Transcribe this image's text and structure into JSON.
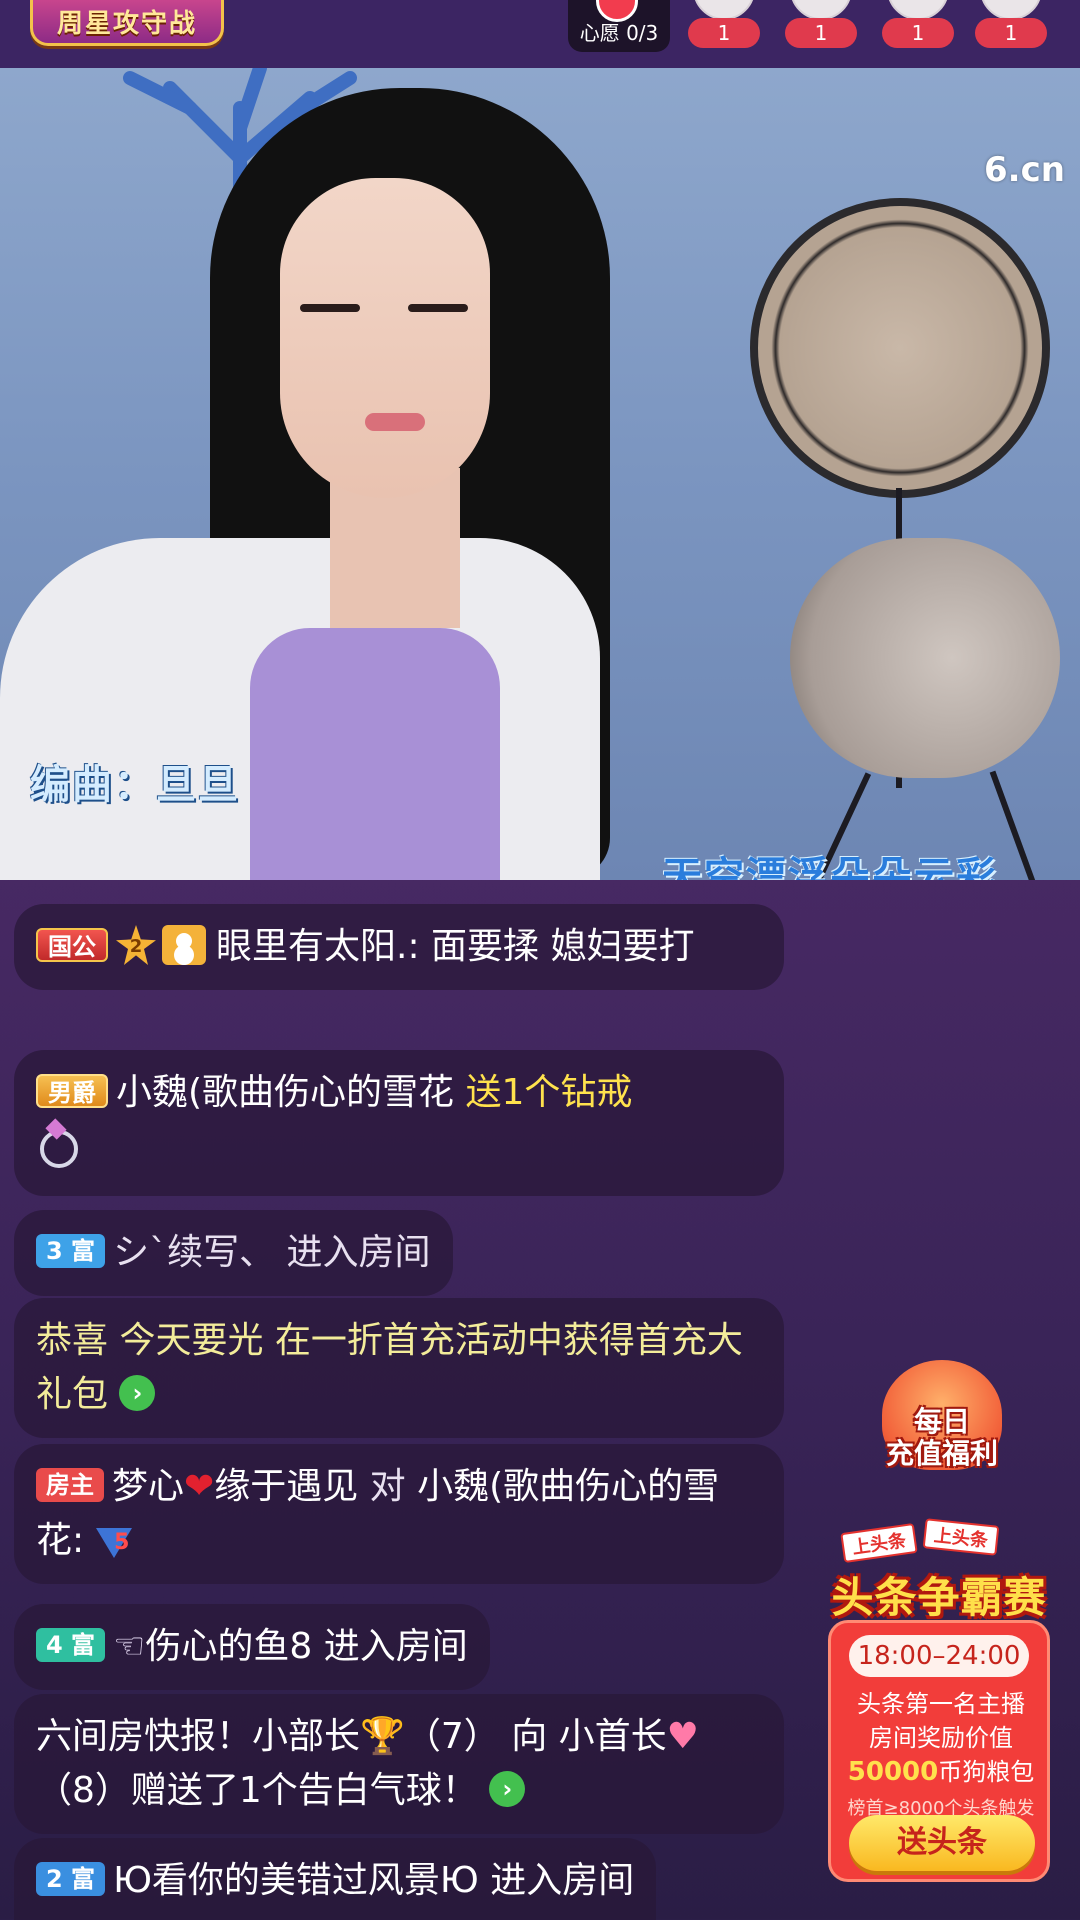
{
  "topbar": {
    "weekly_title": "周星攻守战",
    "wish_label": "心愿 0/3",
    "fans": [
      "1",
      "1",
      "1",
      "1"
    ]
  },
  "video": {
    "watermark": "6.cn",
    "credit": "编曲：旦旦",
    "lyric": "天空漂浮朵朵云彩"
  },
  "chat": [
    {
      "badge": "国公",
      "star_level": "2",
      "text": "眼里有太阳.: 面要揉 媳妇要打"
    },
    {
      "badge": "男爵",
      "user": "小魏(歌曲伤心的雪花",
      "gift_text": "送1个钻戒"
    },
    {
      "badge": "3 富",
      "text": "シ`续写、 进入房间"
    },
    {
      "text": "恭喜 今天要光 在一折首充活动中获得首充大礼包"
    },
    {
      "badge": "房主",
      "user": "梦心",
      "heart": "❤",
      "user2": "缘于遇见",
      "mid": " 对 ",
      "target": "小魏(歌曲伤心的雪花:",
      "level": "5"
    },
    {
      "badge": "4 富",
      "hand": "☜",
      "text": "伤心的鱼8 进入房间"
    },
    {
      "text_a": " 六间房快报！小部长",
      "trophy": "🏆",
      "text_b": "（7） 向 小首长",
      "pheart": "♥",
      "text_c": "（8）赠送了1个告白气球！"
    },
    {
      "badge": "2 富",
      "text": "Ю看你的美错过风景Ю 进入房间"
    }
  ],
  "promo_daily": {
    "label_line1": "每日",
    "label_line2": "充值福利"
  },
  "promo_headline": {
    "tag1": "上头条",
    "tag2": "上头条",
    "title": "头条争霸赛",
    "time": "18:00–24:00",
    "desc1": "头条第一名主播",
    "desc2": "房间奖励价值",
    "reward_num": "50000",
    "reward_unit": "币狗粮包",
    "note": "榜首≥8000个头条触发",
    "button": "送头条"
  },
  "colors": {
    "gold_text": "#ffe24d",
    "accent_red": "#f23d3a",
    "bg": "#3a2562"
  }
}
